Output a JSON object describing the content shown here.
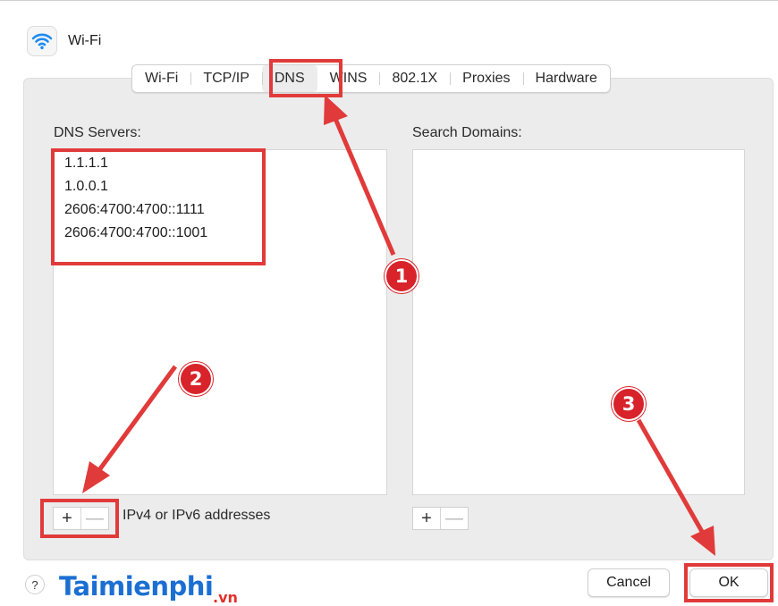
{
  "window": {
    "title": "Wi-Fi",
    "icon": "wifi-icon"
  },
  "tabs": [
    {
      "label": "Wi-Fi",
      "active": false
    },
    {
      "label": "TCP/IP",
      "active": false
    },
    {
      "label": "DNS",
      "active": true
    },
    {
      "label": "WINS",
      "active": false
    },
    {
      "label": "802.1X",
      "active": false
    },
    {
      "label": "Proxies",
      "active": false
    },
    {
      "label": "Hardware",
      "active": false
    }
  ],
  "dns_servers": {
    "label": "DNS Servers:",
    "entries": [
      "1.1.1.1",
      "1.0.0.1",
      "2606:4700:4700::1111",
      "2606:4700:4700::1001"
    ],
    "add_label": "+",
    "remove_label": "—",
    "hint": "IPv4 or IPv6 addresses"
  },
  "search_domains": {
    "label": "Search Domains:",
    "entries": [],
    "add_label": "+",
    "remove_label": "—"
  },
  "footer": {
    "help_label": "?",
    "cancel_label": "Cancel",
    "ok_label": "OK"
  },
  "annotations": {
    "step1": "1",
    "step2": "2",
    "step3": "3",
    "highlight_color": "#e13a3a",
    "step_color": "#d8232a"
  },
  "watermark": {
    "brand": "Taimienphi",
    "suffix": ".vn",
    "brand_color": "#1b6fd2",
    "suffix_color": "#e0302b"
  }
}
